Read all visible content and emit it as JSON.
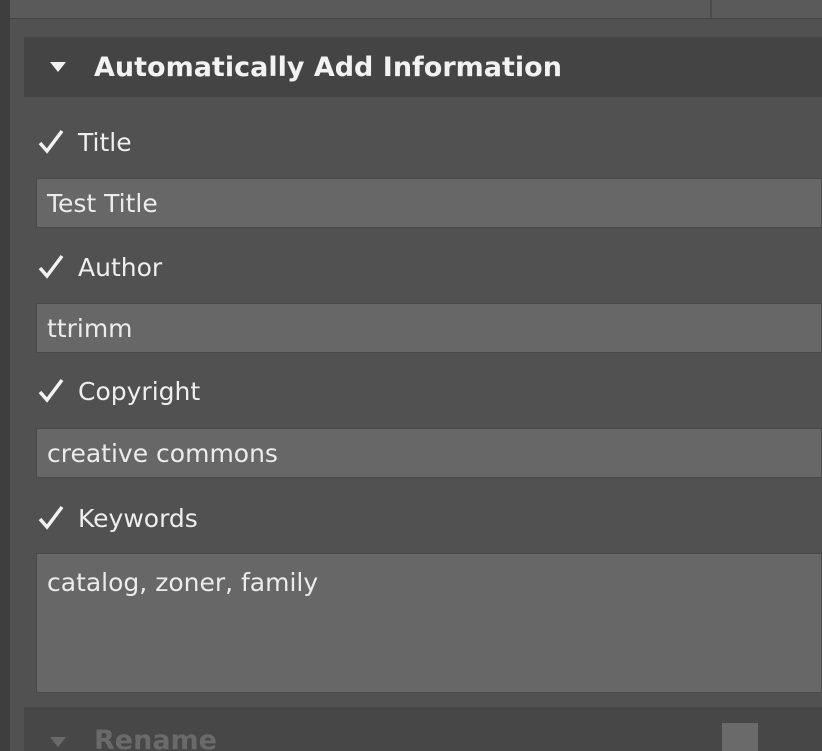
{
  "section": {
    "title": "Automatically Add Information",
    "icon": "chevron-down-icon"
  },
  "fields": [
    {
      "label": "Title",
      "checked": true,
      "value": "Test Title"
    },
    {
      "label": "Author",
      "checked": true,
      "value": "ttrimm"
    },
    {
      "label": "Copyright",
      "checked": true,
      "value": "creative commons"
    },
    {
      "label": "Keywords",
      "checked": true,
      "value": "catalog, zoner, family"
    }
  ],
  "next_section": {
    "title": "Rename"
  },
  "colors": {
    "panel_bg": "#515151",
    "header_bg": "#444444",
    "field_bg": "#676767",
    "text": "#eeeeee",
    "disabled_text": "#6a6a6a"
  }
}
